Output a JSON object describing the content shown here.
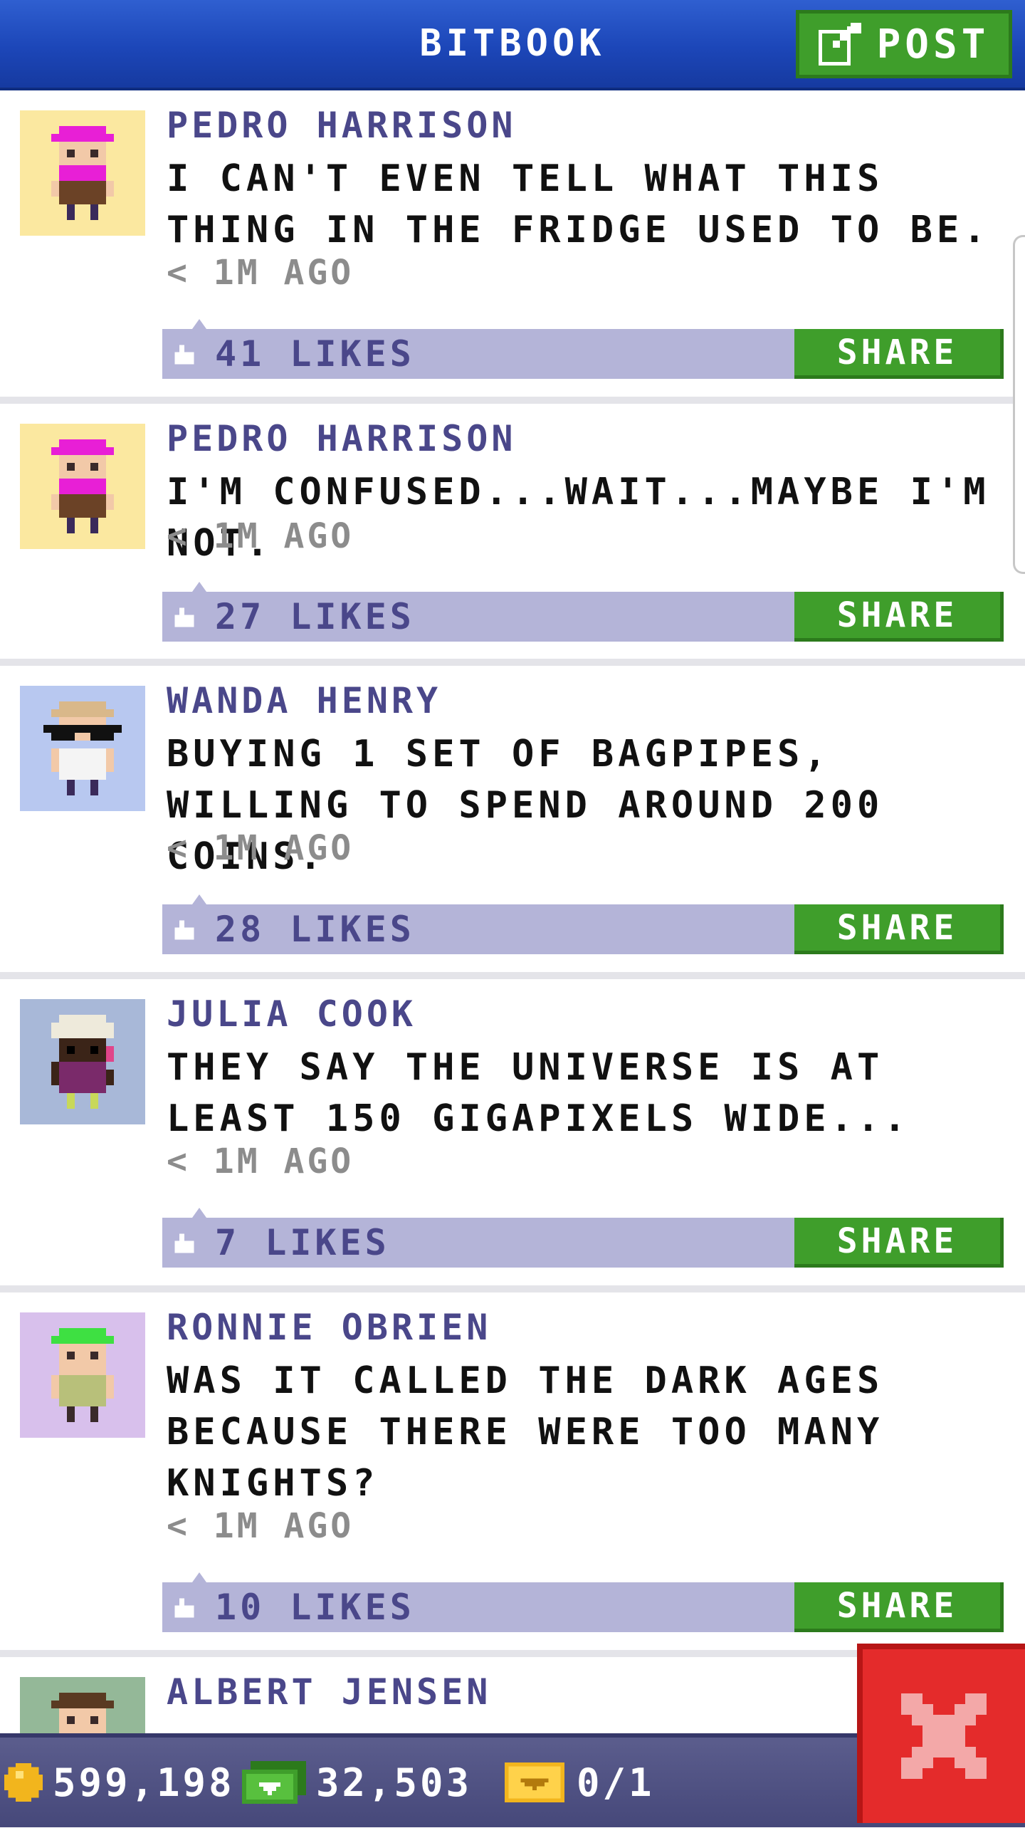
{
  "header": {
    "title": "BITBOOK",
    "post_label": "POST"
  },
  "posts": [
    {
      "author": "PEDRO HARRISON",
      "text": "I CAN'T EVEN TELL WHAT THIS THING IN THE FRIDGE USED TO BE.",
      "time": "< 1M AGO",
      "likes": "41 LIKES",
      "share": "SHARE",
      "avatar": "pink-haired-bearded-man",
      "avatar_bg": "#fbe8a0"
    },
    {
      "author": "PEDRO HARRISON",
      "text": "I'M CONFUSED...WAIT...MAYBE I'M NOT.",
      "time": "< 1M AGO",
      "likes": "27 LIKES",
      "share": "SHARE",
      "avatar": "pink-haired-bearded-man",
      "avatar_bg": "#fbe8a0"
    },
    {
      "author": "WANDA HENRY",
      "text": "BUYING 1 SET OF BAGPIPES, WILLING TO SPEND AROUND 200 COINS.",
      "time": "< 1M AGO",
      "likes": "28 LIKES",
      "share": "SHARE",
      "avatar": "sunglasses-woman",
      "avatar_bg": "#b8c8f0"
    },
    {
      "author": "JULIA COOK",
      "text": "THEY SAY THE UNIVERSE IS AT LEAST 150 GIGAPIXELS WIDE...",
      "time": "< 1M AGO",
      "likes": "7 LIKES",
      "share": "SHARE",
      "avatar": "white-haired-woman",
      "avatar_bg": "#a8b8d8"
    },
    {
      "author": "RONNIE OBRIEN",
      "text": "WAS IT CALLED THE DARK AGES BECAUSE THERE WERE TOO MANY KNIGHTS?",
      "time": "< 1M AGO",
      "likes": "10 LIKES",
      "share": "SHARE",
      "avatar": "green-haired-man",
      "avatar_bg": "#d8c0ec"
    },
    {
      "author": "ALBERT JENSEN",
      "text": "",
      "time": "",
      "likes": "",
      "share": "",
      "avatar": "brown-haired-man",
      "avatar_bg": "#94b898"
    }
  ],
  "status_bar": {
    "coins": "599,198",
    "bux": "32,503",
    "vip": "0/1"
  },
  "colors": {
    "header_blue": "#1c46b8",
    "share_green": "#3f9e2b",
    "like_bar": "#b4b4d8",
    "author_purple": "#4a478a",
    "close_red": "#e42b2b"
  },
  "icons": {
    "post": "edit-icon",
    "coin": "coin-icon",
    "bux": "bux-icon",
    "vip": "vip-ticket-icon",
    "close": "close-icon",
    "like": "thumbs-up-icon"
  }
}
